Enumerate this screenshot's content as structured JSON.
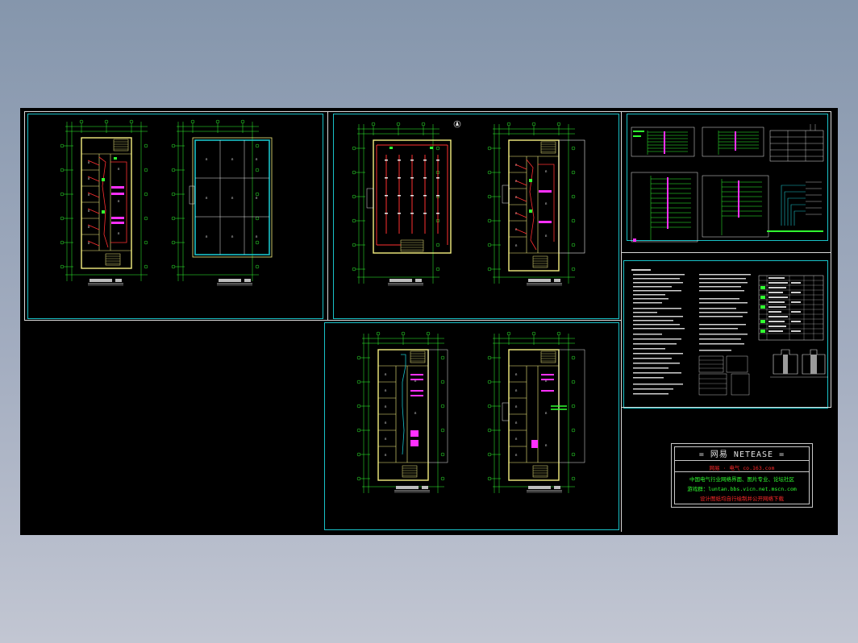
{
  "title_block": {
    "header": "= 网易 NETEASE =",
    "line1": "网易 · 电气 co.163.com",
    "line2": "中国电气行业网络界面、图片专业、论坛社区",
    "line3": "游戏群：luntan.bbs.vicn.net.mscn.com",
    "line4": "设计图纸均自行绘制并公开网络下载"
  },
  "colors": {
    "frame": "#19c2c8",
    "wall": "#f5f080",
    "wire_red": "#ff3030",
    "green": "#30ff30",
    "magenta": "#ff30ff",
    "white": "#e8e8e8",
    "title_red": "#ff2a2a",
    "title_green": "#30ff30"
  }
}
